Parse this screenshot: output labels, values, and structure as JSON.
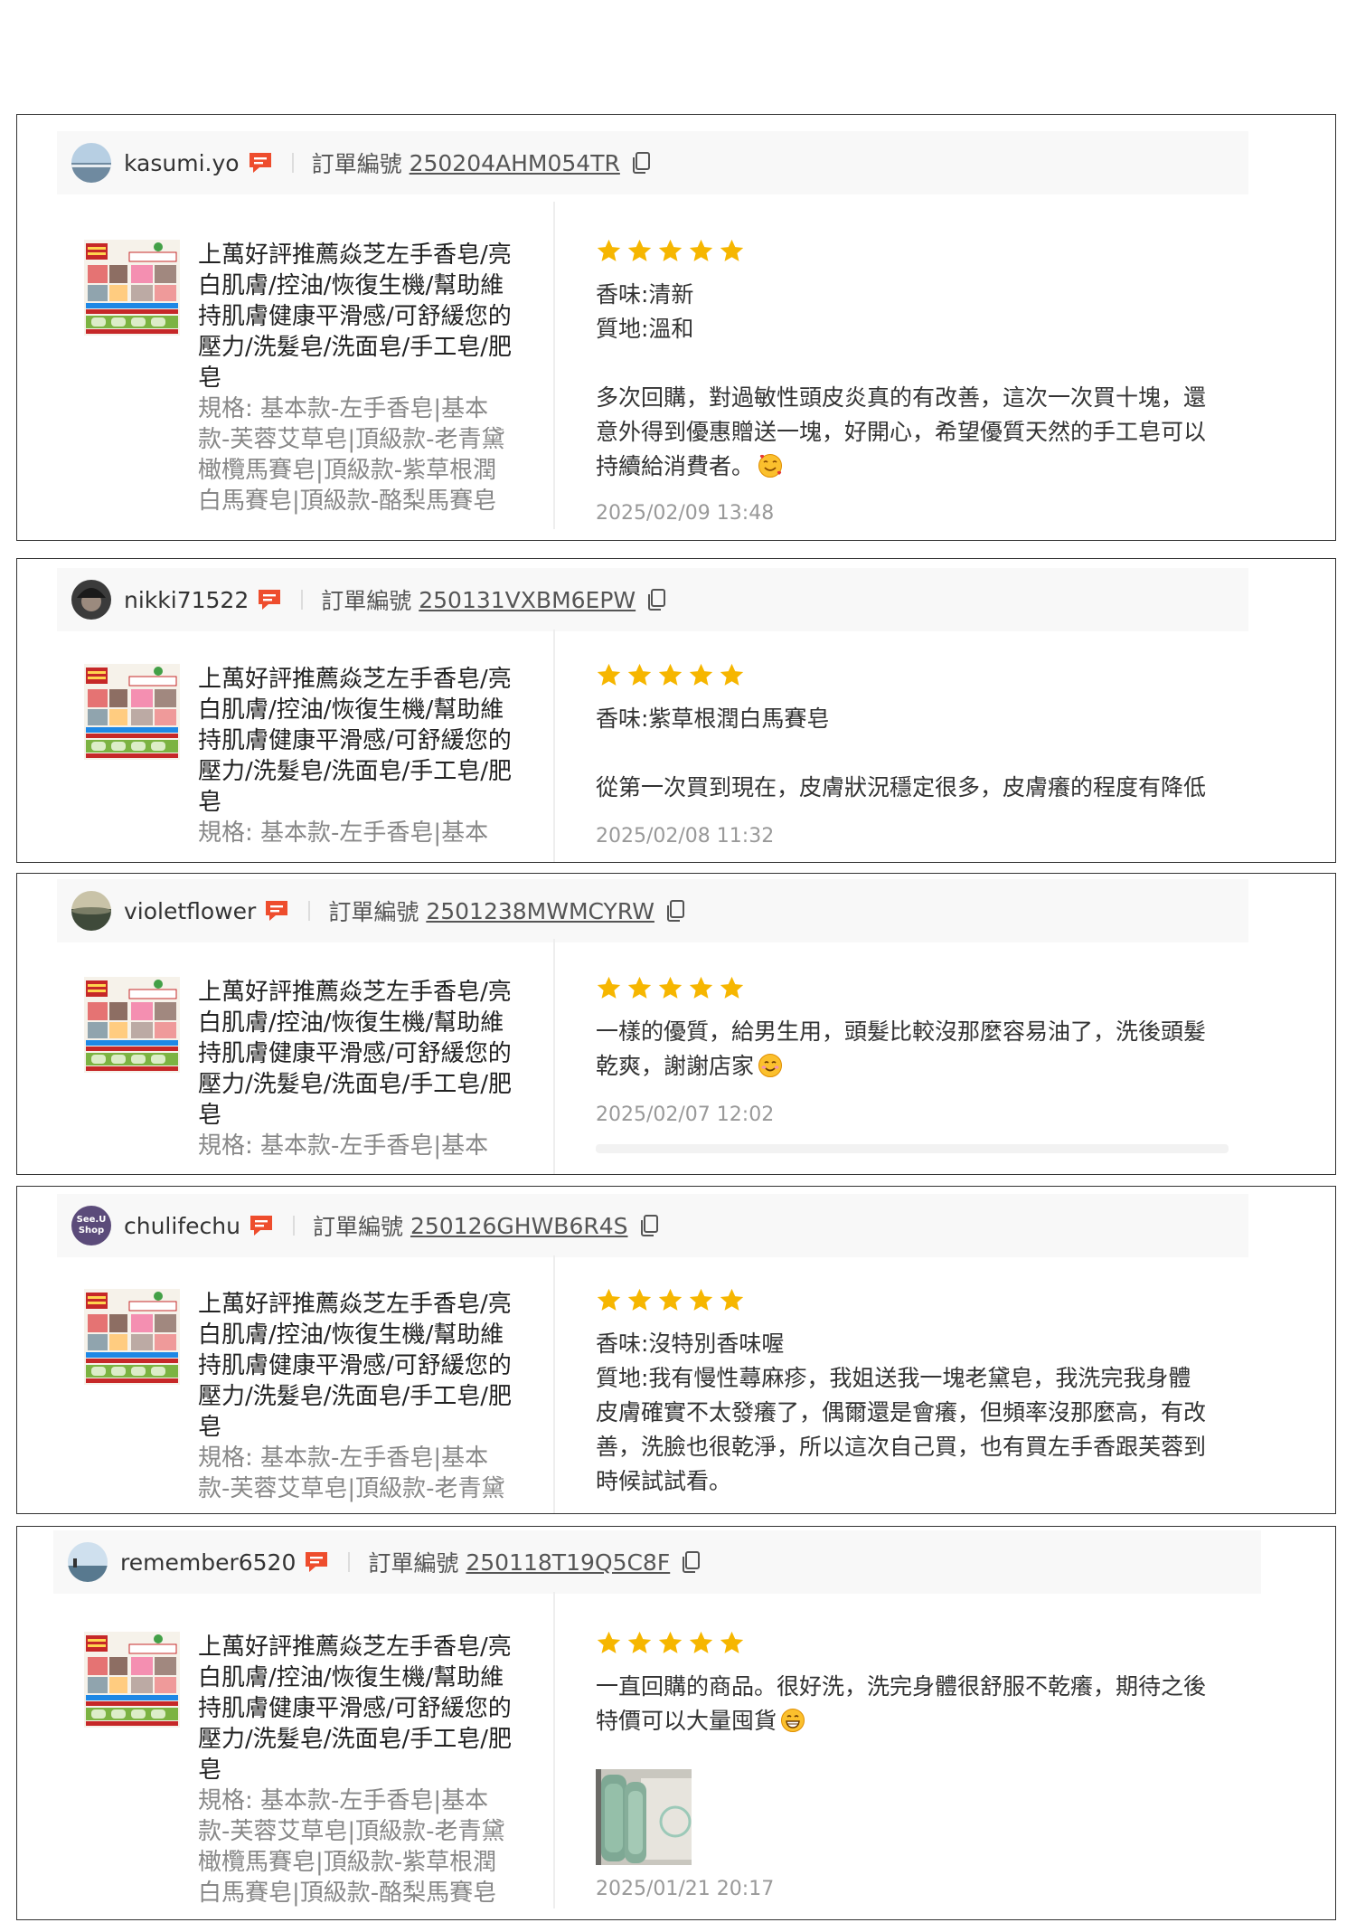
{
  "order_label": "訂單編號",
  "colors": {
    "star": "#f6b600",
    "chat_badge": "#ee4d2d",
    "date": "#999999"
  },
  "product_title": "上萬好評推薦焱芝左手香皂/亮白肌膚/控油/恢復生機/幫助維持肌膚健康平滑感/可舒緩您的壓力/洗髮皂/洗面皂/手工皂/肥皂",
  "reviews": [
    {
      "username": "kasumi.yo",
      "order_no": "250204AHM054TR",
      "rating": 5,
      "product_title_lines": [
        "上萬好評推薦焱芝左手香皂/亮",
        "白肌膚/控油/恢復生機/幫助維",
        "持肌膚健康平滑感/可舒緩您的",
        "壓力/洗髮皂/洗面皂/手工皂/肥",
        "皂"
      ],
      "spec_lines": [
        "規格: 基本款-左手香皂|基本",
        "款-芙蓉艾草皂|頂級款-老青黛",
        "橄欖馬賽皂|頂級款-紫草根潤",
        "白馬賽皂|頂級款-酪梨馬賽皂"
      ],
      "review_lines": [
        "香味:清新",
        "質地:溫和",
        "",
        "多次回購，對過敏性頭皮炎真的有改善，這次一次買十塊，還",
        "意外得到優惠贈送一塊，好開心，希望優質天然的手工皂可以",
        "持續給消費者。"
      ],
      "emoji": "smiling-hearts",
      "date": "2025/02/09 13:48"
    },
    {
      "username": "nikki71522",
      "order_no": "250131VXBM6EPW",
      "rating": 5,
      "product_title_lines": [
        "上萬好評推薦焱芝左手香皂/亮",
        "白肌膚/控油/恢復生機/幫助維",
        "持肌膚健康平滑感/可舒緩您的",
        "壓力/洗髮皂/洗面皂/手工皂/肥",
        "皂"
      ],
      "spec_lines": [
        "規格: 基本款-左手香皂|基本"
      ],
      "review_lines": [
        "香味:紫草根潤白馬賽皂",
        "",
        "從第一次買到現在，皮膚狀況穩定很多，皮膚癢的程度有降低"
      ],
      "date": "2025/02/08 11:32"
    },
    {
      "username": "violetflower",
      "order_no": "2501238MWMCYRW",
      "rating": 5,
      "product_title_lines": [
        "上萬好評推薦焱芝左手香皂/亮",
        "白肌膚/控油/恢復生機/幫助維",
        "持肌膚健康平滑感/可舒緩您的",
        "壓力/洗髮皂/洗面皂/手工皂/肥",
        "皂"
      ],
      "spec_lines": [
        "規格: 基本款-左手香皂|基本"
      ],
      "review_lines": [
        "一樣的優質，給男生用，頭髮比較沒那麼容易油了，洗後頭髮",
        "乾爽，謝謝店家"
      ],
      "emoji": "blush",
      "date": "2025/02/07 12:02"
    },
    {
      "username": "chulifechu",
      "avatar_text": [
        "See.U",
        "Shop"
      ],
      "order_no": "250126GHWB6R4S",
      "rating": 5,
      "product_title_lines": [
        "上萬好評推薦焱芝左手香皂/亮",
        "白肌膚/控油/恢復生機/幫助維",
        "持肌膚健康平滑感/可舒緩您的",
        "壓力/洗髮皂/洗面皂/手工皂/肥",
        "皂"
      ],
      "spec_lines": [
        "規格: 基本款-左手香皂|基本",
        "款-芙蓉艾草皂|頂級款-老青黛"
      ],
      "review_lines": [
        "香味:沒特別香味喔",
        "質地:我有慢性蕁麻疹，我姐送我一塊老黛皂，我洗完我身體",
        "皮膚確實不太發癢了，偶爾還是會癢，但頻率沒那麼高，有改",
        "善，洗臉也很乾淨，所以這次自己買，也有買左手香跟芙蓉到",
        "時候試試看。"
      ]
    },
    {
      "username": "remember6520",
      "order_no": "250118T19Q5C8F",
      "rating": 5,
      "product_title_lines": [
        "上萬好評推薦焱芝左手香皂/亮",
        "白肌膚/控油/恢復生機/幫助維",
        "持肌膚健康平滑感/可舒緩您的",
        "壓力/洗髮皂/洗面皂/手工皂/肥",
        "皂"
      ],
      "spec_lines": [
        "規格: 基本款-左手香皂|基本",
        "款-芙蓉艾草皂|頂級款-老青黛",
        "橄欖馬賽皂|頂級款-紫草根潤",
        "白馬賽皂|頂級款-酪梨馬賽皂"
      ],
      "review_lines": [
        "一直回購的商品。很好洗，洗完身體很舒服不乾癢，期待之後",
        "特價可以大量囤貨"
      ],
      "emoji": "grin",
      "date": "2025/01/21 20:17"
    }
  ]
}
